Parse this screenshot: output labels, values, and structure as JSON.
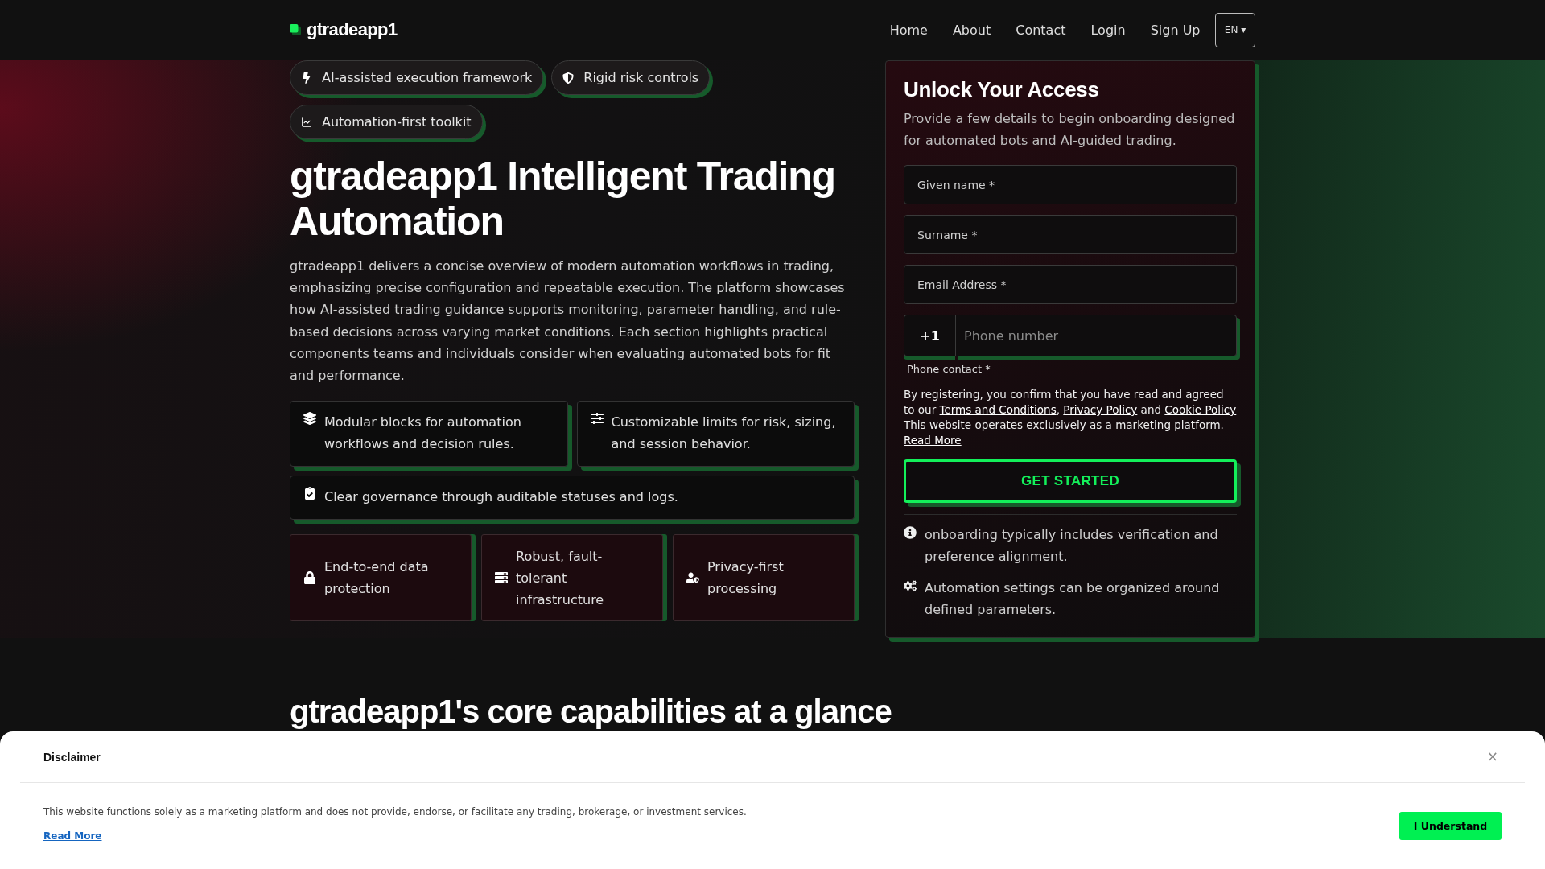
{
  "header": {
    "logo": "gtradeapp1",
    "nav": [
      "Home",
      "About",
      "Contact",
      "Login",
      "Sign Up"
    ],
    "language": "EN ▾"
  },
  "hero": {
    "badges": [
      "AI-assisted execution framework",
      "Rigid risk controls",
      "Automation-first toolkit"
    ],
    "title": "gtradeapp1 Intelligent Trading Automation",
    "description": "gtradeapp1 delivers a concise overview of modern automation workflows in trading, emphasizing precise configuration and repeatable execution. The platform showcases how AI-assisted trading guidance supports monitoring, parameter handling, and rule-based decisions across varying market conditions. Each section highlights practical components teams and individuals consider when evaluating automated bots for fit and performance.",
    "features": [
      "Modular blocks for automation workflows and decision rules.",
      "Customizable limits for risk, sizing, and session behavior.",
      "Clear governance through auditable statuses and logs."
    ],
    "highlights": [
      "End-to-end data protection",
      "Robust, fault-tolerant infrastructure",
      "Privacy-first processing"
    ]
  },
  "form": {
    "title": "Unlock Your Access",
    "subtitle": "Provide a few details to begin onboarding designed for automated bots and AI-guided trading.",
    "fields": [
      {
        "placeholder": "Given name *"
      },
      {
        "placeholder": "Surname *"
      },
      {
        "placeholder": "Email Address *"
      }
    ],
    "phone": {
      "country_code": "+1",
      "placeholder": "Phone number",
      "label": "Phone contact *"
    },
    "consent": [
      {
        "kind": "text",
        "text": "By registering, you confirm that you have read and agreed to our "
      },
      {
        "kind": "link",
        "text": "Terms and Conditions"
      },
      {
        "kind": "text",
        "text": ", "
      },
      {
        "kind": "link",
        "text": "Privacy Policy"
      },
      {
        "kind": "text",
        "text": " and "
      },
      {
        "kind": "link",
        "text": "Cookie Policy"
      },
      {
        "kind": "text",
        "text": " This website operates exclusively as a marketing platform. "
      },
      {
        "kind": "link",
        "text": "Read More"
      }
    ],
    "submit": "GET STARTED",
    "notes": [
      "onboarding typically includes verification and preference alignment.",
      "Automation settings can be organized around defined parameters."
    ]
  },
  "capabilities": {
    "title": "gtradeapp1's core capabilities at a glance"
  },
  "disclaimer": {
    "title": "Disclaimer",
    "close": "×",
    "text": "This website functions solely as a marketing platform and does not provide, endorse, or facilitate any trading, brokerage, or investment services.",
    "link": "Read More",
    "button": "I Understand"
  }
}
